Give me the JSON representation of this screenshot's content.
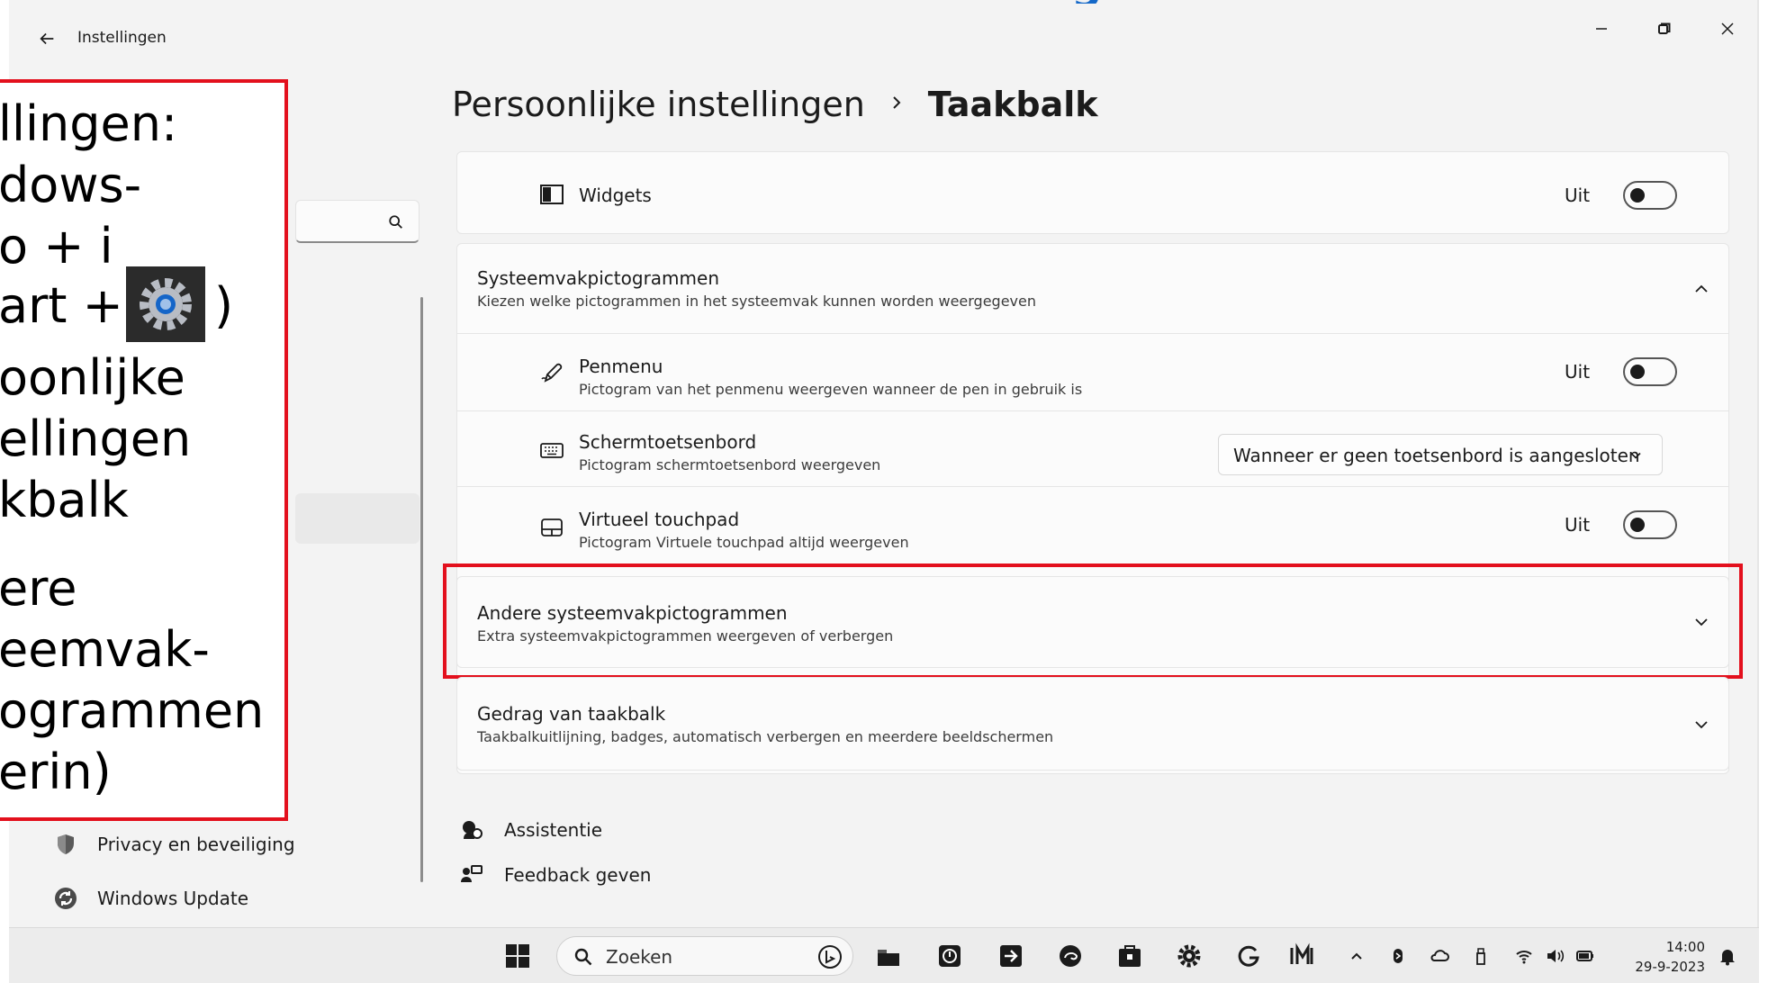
{
  "window": {
    "app_title": "Instellingen",
    "top_heading_fragment": "g"
  },
  "nav": {
    "items": [
      {
        "label": "Privacy en beveiliging",
        "icon": "shield-icon"
      },
      {
        "label": "Windows Update",
        "icon": "windows-update-icon"
      }
    ],
    "selected_fragment": "n",
    "partial_fragment": "n"
  },
  "breadcrumb": {
    "parent": "Persoonlijke instellingen",
    "current": "Taakbalk"
  },
  "widgets": {
    "title": "Widgets",
    "state_label": "Uit",
    "icon": "widgets-icon",
    "on": false
  },
  "systray_section": {
    "title": "Systeemvakpictogrammen",
    "description": "Kiezen welke pictogrammen in het systeemvak kunnen worden weergegeven",
    "expanded": true
  },
  "systray_items": [
    {
      "title": "Penmenu",
      "description": "Pictogram van het penmenu weergeven wanneer de pen in gebruik is",
      "state_label": "Uit",
      "icon": "pen-icon",
      "on": false
    },
    {
      "title": "Schermtoetsenbord",
      "description": "Pictogram schermtoetsenbord weergeven",
      "dropdown_value": "Wanneer er geen toetsenbord is aangesloten",
      "icon": "keyboard-icon"
    },
    {
      "title": "Virtueel touchpad",
      "description": "Pictogram Virtuele touchpad altijd weergeven",
      "state_label": "Uit",
      "icon": "touchpad-icon",
      "on": false
    }
  ],
  "other_systray": {
    "title": "Andere systeemvakpictogrammen",
    "description": "Extra systeemvakpictogrammen weergeven of verbergen",
    "expanded": false,
    "highlight_color": "#e3101d"
  },
  "taskbar_behavior": {
    "title": "Gedrag van taakbalk",
    "description": "Taakbalkuitlijning, badges, automatisch verbergen en meerdere beeldschermen",
    "expanded": false
  },
  "links": {
    "help": "Assistentie",
    "feedback": "Feedback geven"
  },
  "taskbar": {
    "search_placeholder": "Zoeken",
    "time": "14:00",
    "date": "29-9-2023",
    "apps": [
      "start-icon",
      "file-explorer-icon",
      "app-icon",
      "arrow-app-icon",
      "edge-icon",
      "store-icon",
      "settings-icon",
      "grammarly-icon",
      "im-app-icon"
    ],
    "tray": [
      "chevron-up-icon",
      "bluetooth-icon",
      "cloud-icon",
      "usb-icon",
      "wifi-icon",
      "volume-icon",
      "battery-icon",
      "notification-bell-icon"
    ]
  },
  "overlay": {
    "lines": [
      "llingen:",
      "dows-",
      "o + i",
      "art + ",
      ")",
      "oonlijke",
      "ellingen",
      "kbalk",
      "ere",
      "eemvak-",
      "ogrammen",
      "erin)"
    ],
    "border_color": "#e3101d",
    "gear_icon": "settings-gear-icon"
  },
  "colors": {
    "accent": "#1468c8",
    "highlight": "#e3101d"
  }
}
